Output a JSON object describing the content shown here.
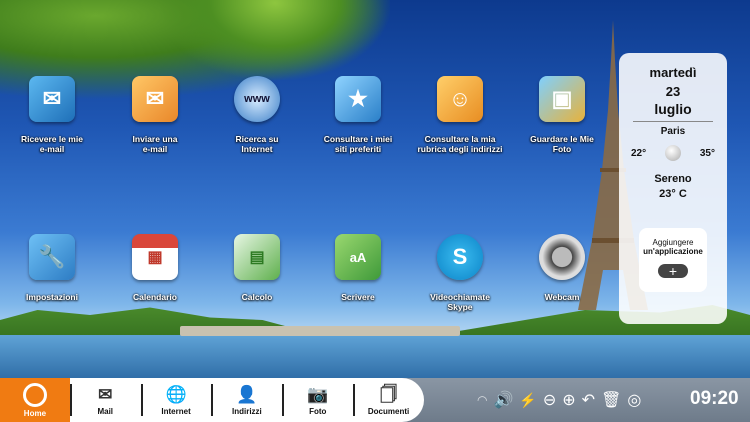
{
  "apps": [
    {
      "label": "Ricevere le mie\ne-mail",
      "icon": "receive-mail-icon",
      "color": "#2a8fd6"
    },
    {
      "label": "Inviare una\ne-mail",
      "icon": "send-mail-icon",
      "color": "#f39c2b"
    },
    {
      "label": "Ricerca su\nInternet",
      "icon": "www-globe-icon",
      "color": "#3a7ec7"
    },
    {
      "label": "Consultare i miei\nsiti preferiti",
      "icon": "favorites-icon",
      "color": "#4aa3df"
    },
    {
      "label": "Consultare la mia\nrubrica degli indirizzi",
      "icon": "address-book-icon",
      "color": "#f0a030"
    },
    {
      "label": "Guardare le Mie\nFoto",
      "icon": "photos-icon",
      "color": "#e8b23a"
    },
    {
      "label": "Impostazioni",
      "icon": "settings-tools-icon",
      "color": "#4aa0e0"
    },
    {
      "label": "Calendario",
      "icon": "calendar-icon",
      "color": "#c0392b"
    },
    {
      "label": "Calcolo",
      "icon": "spreadsheet-icon",
      "color": "#3f9a3a"
    },
    {
      "label": "Scrivere",
      "icon": "document-write-icon",
      "color": "#5ab040"
    },
    {
      "label": "Videochiamate\nSkype",
      "icon": "skype-icon",
      "color": "#1aa1e1"
    },
    {
      "label": "Webcam",
      "icon": "webcam-icon",
      "color": "#888888"
    }
  ],
  "weather": {
    "day": "martedì",
    "date": "23",
    "month": "luglio",
    "city": "Paris",
    "temp_min": "22°",
    "temp_max": "35°",
    "condition": "Sereno",
    "current_temp": "23° C"
  },
  "add_app": {
    "line1": "Aggiungere",
    "line2": "un'applicazione",
    "button": "+"
  },
  "dock": {
    "home": "Home",
    "items": [
      {
        "label": "Mail",
        "icon": "mail-icon",
        "glyph": "✉"
      },
      {
        "label": "Internet",
        "icon": "globe-icon",
        "glyph": "🌐"
      },
      {
        "label": "Indirizzi",
        "icon": "contacts-icon",
        "glyph": "👤"
      },
      {
        "label": "Foto",
        "icon": "camera-icon",
        "glyph": "📷"
      },
      {
        "label": "Documenti",
        "icon": "documents-icon",
        "glyph": "🗍"
      }
    ]
  },
  "tray": {
    "clock": "09:20"
  },
  "colors": {
    "home_accent": "#f07b12",
    "taskbar": "#7a8795"
  }
}
